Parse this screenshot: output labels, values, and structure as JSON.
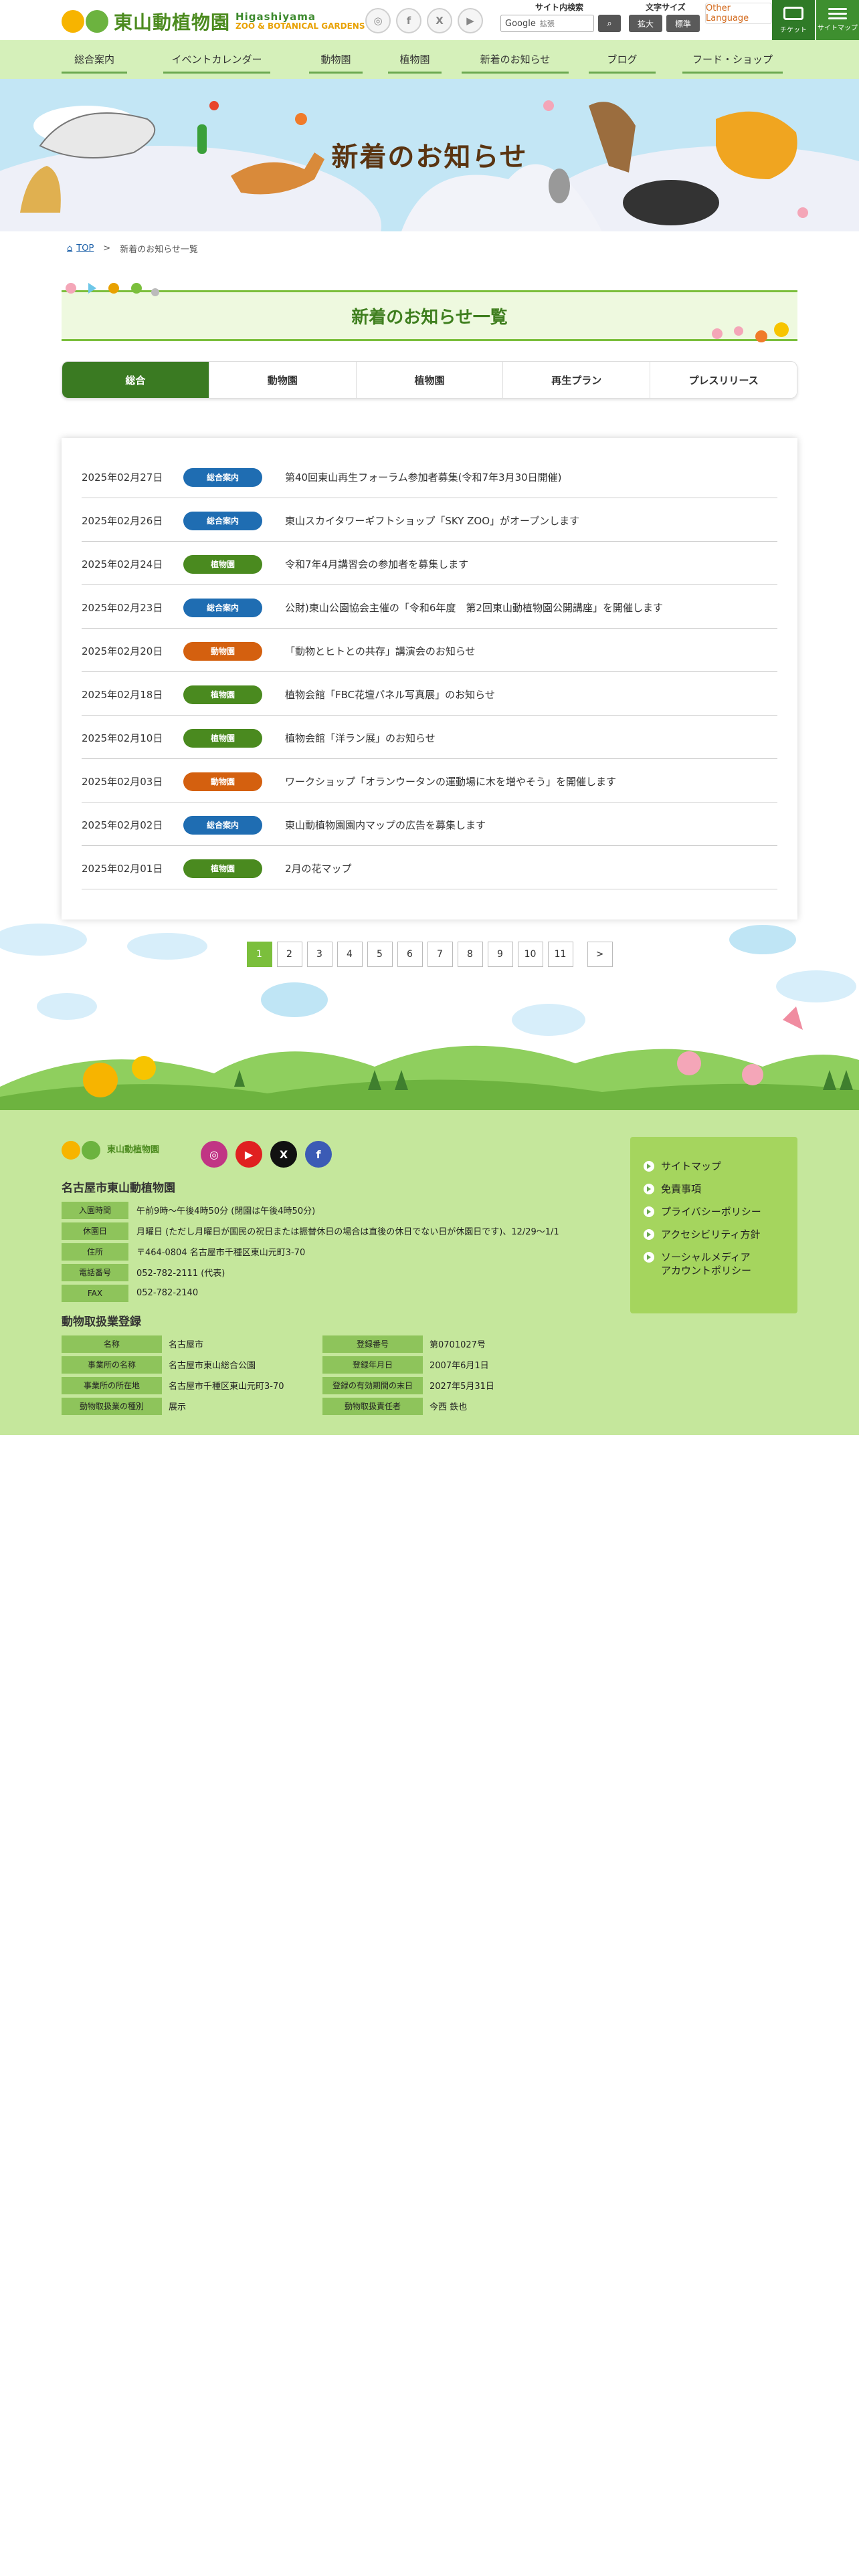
{
  "header": {
    "logo_title": "東山動植物園",
    "logo_en1": "Higashiyama",
    "logo_en2": "ZOO & BOTANICAL GARDENS",
    "sns": [
      "instagram-icon",
      "facebook-icon",
      "x-icon",
      "youtube-icon"
    ],
    "search_label": "サイト内検索",
    "search_google": "Google",
    "search_placeholder": "拡張",
    "font_size_label": "文字サイズ",
    "font_large": "拡大",
    "font_standard": "標準",
    "other_language": "Other Language",
    "ticket_label": "チケット",
    "menu_label": "サイトマップ"
  },
  "nav": [
    "総合案内",
    "イベントカレンダー",
    "動物園",
    "植物園",
    "新着のお知らせ",
    "ブログ",
    "フード・ショップ"
  ],
  "hero": {
    "title": "新着のお知らせ"
  },
  "breadcrumb": {
    "top": "TOP",
    "separator": ">",
    "current": "新着のお知らせ一覧"
  },
  "section_title": "新着のお知らせ一覧",
  "tabs": [
    "総合",
    "動物園",
    "植物園",
    "再生プラン",
    "プレスリリース"
  ],
  "news": [
    {
      "date": "2025年02月27日",
      "category": "総合案内",
      "title": "第40回東山再生フォーラム参加者募集(令和7年3月30日開催)"
    },
    {
      "date": "2025年02月26日",
      "category": "総合案内",
      "title": "東山スカイタワーギフトショップ「SKY ZOO」がオープンします"
    },
    {
      "date": "2025年02月24日",
      "category": "植物園",
      "title": "令和7年4月講習会の参加者を募集します"
    },
    {
      "date": "2025年02月23日",
      "category": "総合案内",
      "title": "公財)東山公園協会主催の「令和6年度　第2回東山動植物園公開講座」を開催します"
    },
    {
      "date": "2025年02月20日",
      "category": "動物園",
      "title": "「動物とヒトとの共存」講演会のお知らせ"
    },
    {
      "date": "2025年02月18日",
      "category": "植物園",
      "title": "植物会館「FBC花壇パネル写真展」のお知らせ"
    },
    {
      "date": "2025年02月10日",
      "category": "植物園",
      "title": "植物会館「洋ラン展」のお知らせ"
    },
    {
      "date": "2025年02月03日",
      "category": "動物園",
      "title": "ワークショップ「オランウータンの運動場に木を増やそう」を開催します"
    },
    {
      "date": "2025年02月02日",
      "category": "総合案内",
      "title": "東山動植物園園内マップの広告を募集します"
    },
    {
      "date": "2025年02月01日",
      "category": "植物園",
      "title": "2月の花マップ"
    }
  ],
  "category_colors": {
    "総合案内": "#1f6db2",
    "植物園": "#4a8a1f",
    "動物園": "#d4600f"
  },
  "pagination": {
    "pages": [
      "1",
      "2",
      "3",
      "4",
      "5",
      "6",
      "7",
      "8",
      "9",
      "10",
      "11"
    ],
    "current": "1",
    "next": ">"
  },
  "footer": {
    "org_name": "名古屋市東山動植物園",
    "logo_text": "東山動植物園",
    "sns": [
      "instagram-icon",
      "youtube-icon",
      "x-icon",
      "facebook-icon"
    ],
    "info": [
      {
        "label": "入園時間",
        "value": "午前9時～午後4時50分 (閉園は午後4時50分)"
      },
      {
        "label": "休園日",
        "value": "月曜日 (ただし月曜日が国民の祝日または振替休日の場合は直後の休日でない日が休園日です)、12/29～1/1"
      },
      {
        "label": "住所",
        "value": "〒464-0804 名古屋市千種区東山元町3-70"
      },
      {
        "label": "電話番号",
        "value": "052-782-2111 (代表)"
      },
      {
        "label": "FAX",
        "value": "052-782-2140"
      }
    ],
    "registration_title": "動物取扱業登録",
    "registration": [
      [
        {
          "label": "名称",
          "value": "名古屋市"
        },
        {
          "label": "登録番号",
          "value": "第0701027号"
        }
      ],
      [
        {
          "label": "事業所の名称",
          "value": "名古屋市東山総合公園"
        },
        {
          "label": "登録年月日",
          "value": "2007年6月1日"
        }
      ],
      [
        {
          "label": "事業所の所在地",
          "value": "名古屋市千種区東山元町3-70"
        },
        {
          "label": "登録の有効期間の末日",
          "value": "2027年5月31日"
        }
      ],
      [
        {
          "label": "動物取扱業の種別",
          "value": "展示"
        },
        {
          "label": "動物取扱責任者",
          "value": "今西 鉄也"
        }
      ]
    ],
    "links": [
      "サイトマップ",
      "免責事項",
      "プライバシーポリシー",
      "アクセシビリティ方針",
      "ソーシャルメディアアカウントポリシー"
    ]
  }
}
